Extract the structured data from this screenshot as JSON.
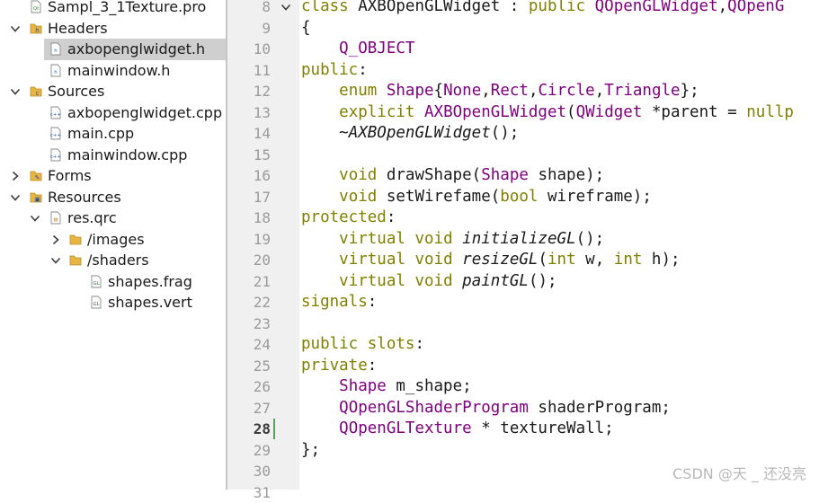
{
  "project_tree": {
    "items": [
      {
        "label": "Sampl_3_1Texture.pro",
        "icon": "pro-file-icon",
        "expanded": null
      },
      {
        "label": "Headers",
        "icon": "headers-folder-icon",
        "expanded": true
      },
      {
        "label": "axbopenglwidget.h",
        "icon": "header-file-icon",
        "expanded": null,
        "selected": true
      },
      {
        "label": "mainwindow.h",
        "icon": "header-file-icon",
        "expanded": null
      },
      {
        "label": "Sources",
        "icon": "sources-folder-icon",
        "expanded": true
      },
      {
        "label": "axbopenglwidget.cpp",
        "icon": "cpp-file-icon",
        "expanded": null
      },
      {
        "label": "main.cpp",
        "icon": "cpp-file-icon",
        "expanded": null
      },
      {
        "label": "mainwindow.cpp",
        "icon": "cpp-file-icon",
        "expanded": null
      },
      {
        "label": "Forms",
        "icon": "forms-folder-icon",
        "expanded": false
      },
      {
        "label": "Resources",
        "icon": "resources-folder-icon",
        "expanded": true
      },
      {
        "label": "res.qrc",
        "icon": "qrc-file-icon",
        "expanded": true
      },
      {
        "label": "/images",
        "icon": "folder-icon",
        "expanded": false
      },
      {
        "label": "/shaders",
        "icon": "folder-icon",
        "expanded": true
      },
      {
        "label": "shapes.frag",
        "icon": "glsl-file-icon",
        "expanded": null
      },
      {
        "label": "shapes.vert",
        "icon": "glsl-file-icon",
        "expanded": null
      }
    ]
  },
  "editor": {
    "current_line": "28",
    "lines": [
      {
        "num": "8",
        "text": "class AXBOpenGLWidget : public QOpenGLWidget,QOpenG",
        "tokens": [
          [
            "class",
            "kw"
          ],
          [
            " AXBOpenGLWidget : ",
            ""
          ],
          [
            "public",
            "kw"
          ],
          [
            " ",
            ""
          ],
          [
            "QOpenGLWidget",
            "ty"
          ],
          [
            ",",
            ""
          ],
          [
            "QOpenG",
            "ty"
          ]
        ]
      },
      {
        "num": "9",
        "text": "{",
        "tokens": [
          [
            "{",
            ""
          ]
        ]
      },
      {
        "num": "10",
        "text": "    Q_OBJECT",
        "tokens": [
          [
            "    ",
            ""
          ],
          [
            "Q_OBJECT",
            "ty"
          ]
        ]
      },
      {
        "num": "11",
        "text": "public:",
        "tokens": [
          [
            "public",
            "kw"
          ],
          [
            ":",
            ""
          ]
        ]
      },
      {
        "num": "12",
        "text": "    enum Shape{None,Rect,Circle,Triangle};",
        "tokens": [
          [
            "    ",
            ""
          ],
          [
            "enum",
            "kw"
          ],
          [
            " ",
            ""
          ],
          [
            "Shape",
            "ty"
          ],
          [
            "{",
            ""
          ],
          [
            "None",
            "ty"
          ],
          [
            ",",
            ""
          ],
          [
            "Rect",
            "ty"
          ],
          [
            ",",
            ""
          ],
          [
            "Circle",
            "ty"
          ],
          [
            ",",
            ""
          ],
          [
            "Triangle",
            "ty"
          ],
          [
            "};",
            ""
          ]
        ]
      },
      {
        "num": "13",
        "text": "    explicit AXBOpenGLWidget(QWidget *parent = nullp",
        "tokens": [
          [
            "    ",
            ""
          ],
          [
            "explicit",
            "kw"
          ],
          [
            " ",
            ""
          ],
          [
            "AXBOpenGLWidget",
            "ty"
          ],
          [
            "(",
            ""
          ],
          [
            "QWidget",
            "ty"
          ],
          [
            " *parent = ",
            ""
          ],
          [
            "nullp",
            "kw"
          ]
        ]
      },
      {
        "num": "14",
        "text": "    ~AXBOpenGLWidget();",
        "tokens": [
          [
            "    ",
            ""
          ],
          [
            "~AXBOpenGLWidget",
            "it"
          ],
          [
            "();",
            ""
          ]
        ]
      },
      {
        "num": "15",
        "text": "",
        "tokens": []
      },
      {
        "num": "16",
        "text": "    void drawShape(Shape shape);",
        "tokens": [
          [
            "    ",
            ""
          ],
          [
            "void",
            "kw"
          ],
          [
            " drawShape(",
            ""
          ],
          [
            "Shape",
            "ty"
          ],
          [
            " shape);",
            ""
          ]
        ]
      },
      {
        "num": "17",
        "text": "    void setWirefame(bool wireframe);",
        "tokens": [
          [
            "    ",
            ""
          ],
          [
            "void",
            "kw"
          ],
          [
            " setWirefame(",
            ""
          ],
          [
            "bool",
            "kw"
          ],
          [
            " wireframe);",
            ""
          ]
        ]
      },
      {
        "num": "18",
        "text": "protected:",
        "tokens": [
          [
            "protected",
            "kw"
          ],
          [
            ":",
            ""
          ]
        ]
      },
      {
        "num": "19",
        "text": "    virtual void initializeGL();",
        "tokens": [
          [
            "    ",
            ""
          ],
          [
            "virtual",
            "kw"
          ],
          [
            " ",
            ""
          ],
          [
            "void",
            "kw"
          ],
          [
            " ",
            ""
          ],
          [
            "initializeGL",
            "it"
          ],
          [
            "();",
            ""
          ]
        ]
      },
      {
        "num": "20",
        "text": "    virtual void resizeGL(int w, int h);",
        "tokens": [
          [
            "    ",
            ""
          ],
          [
            "virtual",
            "kw"
          ],
          [
            " ",
            ""
          ],
          [
            "void",
            "kw"
          ],
          [
            " ",
            ""
          ],
          [
            "resizeGL",
            "it"
          ],
          [
            "(",
            ""
          ],
          [
            "int",
            "kw"
          ],
          [
            " w, ",
            ""
          ],
          [
            "int",
            "kw"
          ],
          [
            " h);",
            ""
          ]
        ]
      },
      {
        "num": "21",
        "text": "    virtual void paintGL();",
        "tokens": [
          [
            "    ",
            ""
          ],
          [
            "virtual",
            "kw"
          ],
          [
            " ",
            ""
          ],
          [
            "void",
            "kw"
          ],
          [
            " ",
            ""
          ],
          [
            "paintGL",
            "it"
          ],
          [
            "();",
            ""
          ]
        ]
      },
      {
        "num": "22",
        "text": "signals:",
        "tokens": [
          [
            "signals",
            "kw"
          ],
          [
            ":",
            ""
          ]
        ]
      },
      {
        "num": "23",
        "text": "",
        "tokens": []
      },
      {
        "num": "24",
        "text": "public slots:",
        "tokens": [
          [
            "public",
            "kw"
          ],
          [
            " ",
            ""
          ],
          [
            "slots",
            "kw"
          ],
          [
            ":",
            ""
          ]
        ]
      },
      {
        "num": "25",
        "text": "private:",
        "tokens": [
          [
            "private",
            "kw"
          ],
          [
            ":",
            ""
          ]
        ]
      },
      {
        "num": "26",
        "text": "    Shape m_shape;",
        "tokens": [
          [
            "    ",
            ""
          ],
          [
            "Shape",
            "ty"
          ],
          [
            " m_shape;",
            ""
          ]
        ]
      },
      {
        "num": "27",
        "text": "    QOpenGLShaderProgram shaderProgram;",
        "tokens": [
          [
            "    ",
            ""
          ],
          [
            "QOpenGLShaderProgram",
            "ty"
          ],
          [
            " shaderProgram;",
            ""
          ]
        ]
      },
      {
        "num": "28",
        "text": "    QOpenGLTexture * textureWall;",
        "tokens": [
          [
            "    ",
            ""
          ],
          [
            "QOpenGLTexture",
            "ty"
          ],
          [
            " * textureWall;",
            ""
          ]
        ]
      },
      {
        "num": "29",
        "text": "};",
        "tokens": [
          [
            "};",
            ""
          ]
        ]
      },
      {
        "num": "30",
        "text": "",
        "tokens": []
      },
      {
        "num": "31",
        "text": "",
        "tokens": []
      }
    ]
  },
  "watermark": "CSDN @天 _ 还没亮",
  "colors": {
    "keyword": "#808000",
    "type": "#800080",
    "selection": "#cfcfcf",
    "line_numbers": "#9b9b9b"
  }
}
